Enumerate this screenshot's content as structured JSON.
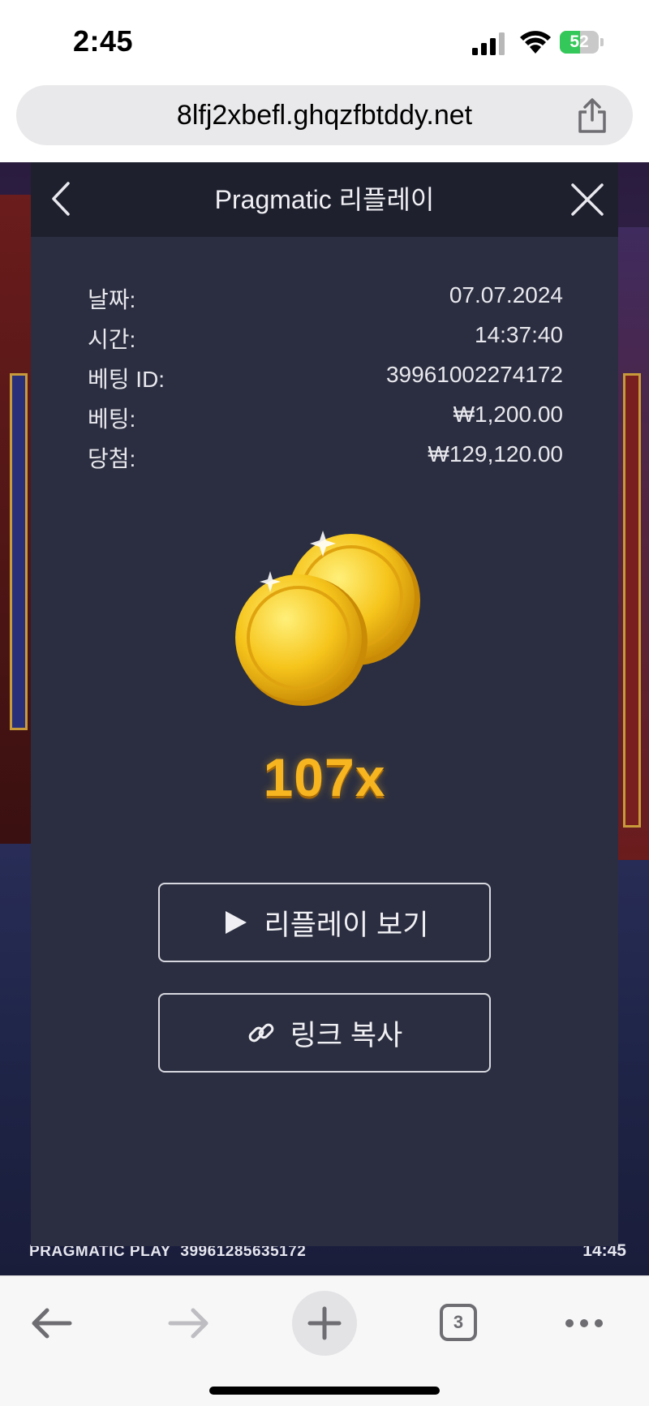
{
  "status_bar": {
    "time": "2:45",
    "battery": "52",
    "battery_level_percent": 52
  },
  "browser": {
    "url": "8lfj2xbefl.ghqzfbtddy.net",
    "tab_count": "3"
  },
  "game_footer": {
    "brand": "PRAGMATIC PLAY",
    "round_id": "39961285635172",
    "clock": "14:45"
  },
  "modal": {
    "title": "Pragmatic 리플레이",
    "rows": [
      {
        "label": "날짜:",
        "value": "07.07.2024"
      },
      {
        "label": "시간:",
        "value": "14:37:40"
      },
      {
        "label": "베팅 ID:",
        "value": "39961002274172"
      },
      {
        "label": "베팅:",
        "value": "₩1,200.00"
      },
      {
        "label": "당첨:",
        "value": "₩129,120.00"
      }
    ],
    "multiplier": "107x",
    "replay_button": "리플레이 보기",
    "copy_link_button": "링크 복사"
  },
  "colors": {
    "modal_bg": "#2b2e40",
    "modal_header_bg": "#1e202e",
    "multiplier": "#f7b51f",
    "battery_green": "#34c759"
  },
  "icons": [
    "signal-icon",
    "wifi-icon",
    "share-icon",
    "back-chevron-icon",
    "close-icon",
    "gold-coins-icon",
    "play-icon",
    "link-icon",
    "back-arrow-icon",
    "forward-arrow-icon",
    "plus-icon",
    "tabs-icon",
    "more-icon"
  ]
}
